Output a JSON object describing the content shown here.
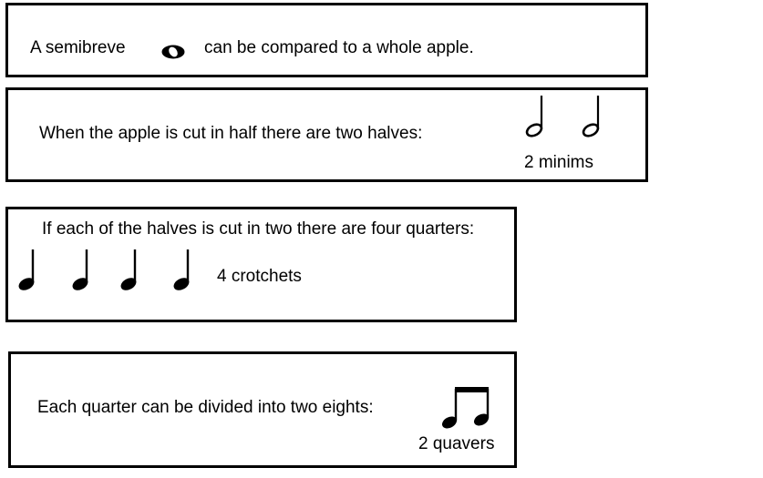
{
  "panels": [
    {
      "text_before": "A semibreve",
      "text_after": "can be compared to a whole apple.",
      "symbol_icon": "semibreve-icon"
    },
    {
      "text": "When the apple is cut in half there are two halves:",
      "caption": "2 minims",
      "symbol_icon": "minim-icon",
      "symbol_count": 2
    },
    {
      "text": "If each of the halves is cut in two there are four quarters:",
      "caption": "4 crotchets",
      "symbol_icon": "crotchet-icon",
      "symbol_count": 4
    },
    {
      "text": "Each quarter can be divided into two eights:",
      "caption": "2 quavers",
      "symbol_icon": "beamed-quavers-icon",
      "symbol_count": 2
    }
  ]
}
